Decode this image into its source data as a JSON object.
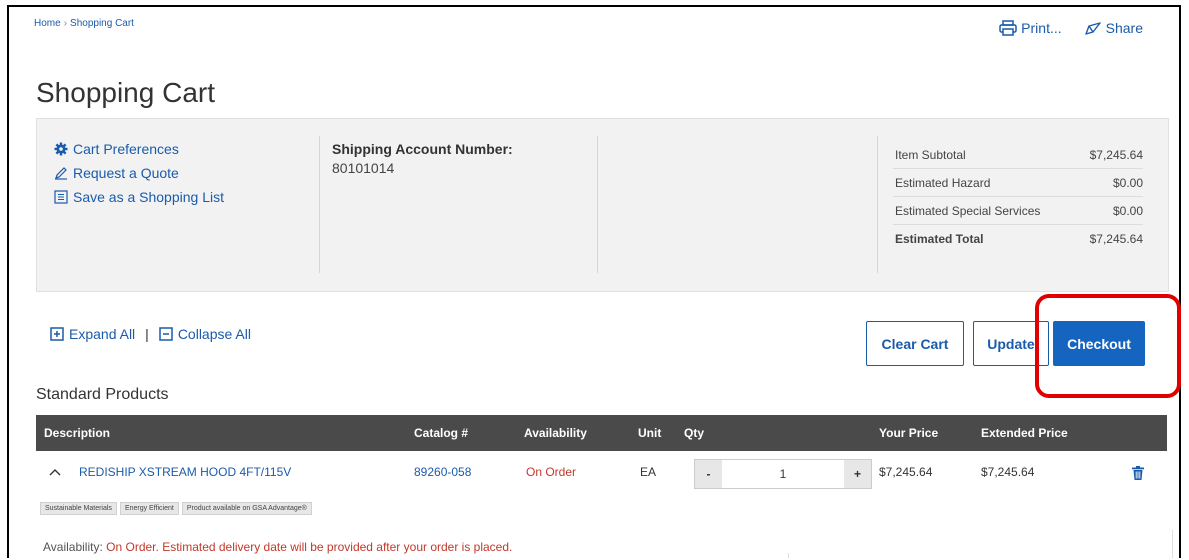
{
  "breadcrumb": {
    "home": "Home",
    "separator": "›",
    "current": "Shopping Cart"
  },
  "top_actions": {
    "print": "Print...",
    "share": "Share"
  },
  "page_title": "Shopping Cart",
  "preferences": [
    {
      "label": "Cart Preferences",
      "icon": "gear-icon"
    },
    {
      "label": "Request a Quote",
      "icon": "edit-icon"
    },
    {
      "label": "Save as a Shopping List",
      "icon": "list-icon"
    }
  ],
  "shipping": {
    "label": "Shipping Account Number:",
    "value": "80101014"
  },
  "totals": [
    {
      "label": "Item Subtotal",
      "value": "$7,245.64"
    },
    {
      "label": "Estimated Hazard",
      "value": "$0.00"
    },
    {
      "label": "Estimated Special Services",
      "value": "$0.00"
    },
    {
      "label": "Estimated Total",
      "value": "$7,245.64"
    }
  ],
  "expand": {
    "expand_all": "Expand All",
    "divider": "|",
    "collapse_all": "Collapse All"
  },
  "buttons": {
    "clear_cart": "Clear Cart",
    "update": "Update",
    "checkout": "Checkout"
  },
  "section_title": "Standard Products",
  "table": {
    "headers": {
      "description": "Description",
      "catalog": "Catalog #",
      "availability": "Availability",
      "unit": "Unit",
      "qty": "Qty",
      "your_price": "Your Price",
      "extended_price": "Extended Price"
    },
    "rows": [
      {
        "chevron": "^",
        "description": "REDISHIP XSTREAM HOOD 4FT/115V",
        "catalog": "89260-058",
        "availability": "On Order",
        "unit": "EA",
        "qty": "1",
        "minus": "-",
        "plus": "+",
        "your_price": "$7,245.64",
        "extended_price": "$7,245.64"
      }
    ]
  },
  "tags": [
    "Sustainable Materials",
    "Energy Efficient",
    "Product available on GSA Advantage®"
  ],
  "availability_note": {
    "label": "Availability:",
    "status": "On Order.",
    "message": "Estimated delivery date will be provided after your order is placed."
  },
  "colors": {
    "link": "#1a5bab",
    "primary": "#1565c0",
    "header_bg": "#4a4a4a",
    "status_red": "#c0392b",
    "highlight": "#e00000"
  }
}
